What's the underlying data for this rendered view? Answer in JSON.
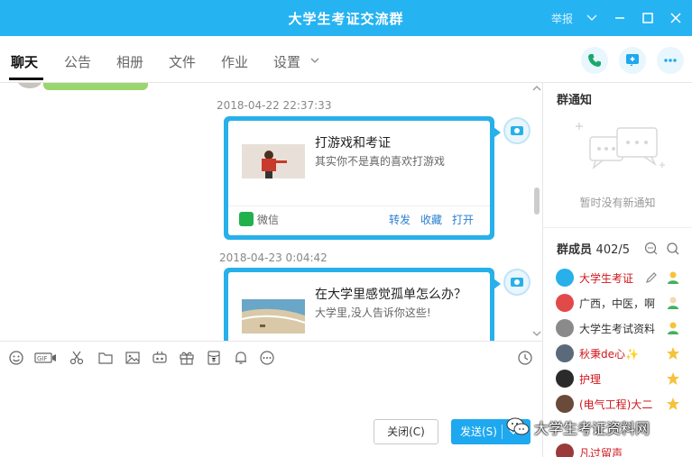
{
  "window": {
    "title": "大学生考证交流群",
    "report": "举报"
  },
  "tabs": [
    {
      "label": "聊天",
      "active": true
    },
    {
      "label": "公告"
    },
    {
      "label": "相册"
    },
    {
      "label": "文件"
    },
    {
      "label": "作业"
    },
    {
      "label": "设置"
    }
  ],
  "messages": [
    {
      "timestamp": "2018-04-22 22:37:33",
      "title": "打游戏和考证",
      "desc": "其实你不是真的喜欢打游戏",
      "source": "微信",
      "actions": [
        "转发",
        "收藏",
        "打开"
      ]
    },
    {
      "timestamp": "2018-04-23 0:04:42",
      "title": "在大学里感觉孤单怎么办？",
      "desc": "大学里,没人告诉你这些!"
    }
  ],
  "input": {
    "close_label": "关闭(C)",
    "send_label": "发送(S)"
  },
  "side": {
    "notice_title": "群通知",
    "notice_empty": "暂时没有新通知",
    "members_title": "群成员",
    "members_count": "402/5",
    "members": [
      {
        "name": "大学生考证",
        "color": "#d0161b",
        "avatar": "#27b0ea"
      },
      {
        "name": "广西，中医，啊",
        "color": "#333333",
        "avatar": "#e24a4a"
      },
      {
        "name": "大学生考试资料",
        "color": "#333333",
        "avatar": "#8a8a8a"
      },
      {
        "name": "秋秉de心✨",
        "color": "#d0161b",
        "avatar": "#5a6a7a"
      },
      {
        "name": "护理",
        "color": "#d0161b",
        "avatar": "#2a2a2a"
      },
      {
        "name": "(电气工程)大二",
        "color": "#d0161b",
        "avatar": "#6a4a3a"
      },
      {
        "name": "凡过留声",
        "color": "#d0161b",
        "avatar": "#9a3a3a"
      }
    ]
  },
  "watermark": "大学生考证资料网",
  "colors": {
    "accent": "#26b3f2",
    "card_border": "#27b0ea",
    "link": "#2a7fd0",
    "owner_red": "#d0161b"
  }
}
